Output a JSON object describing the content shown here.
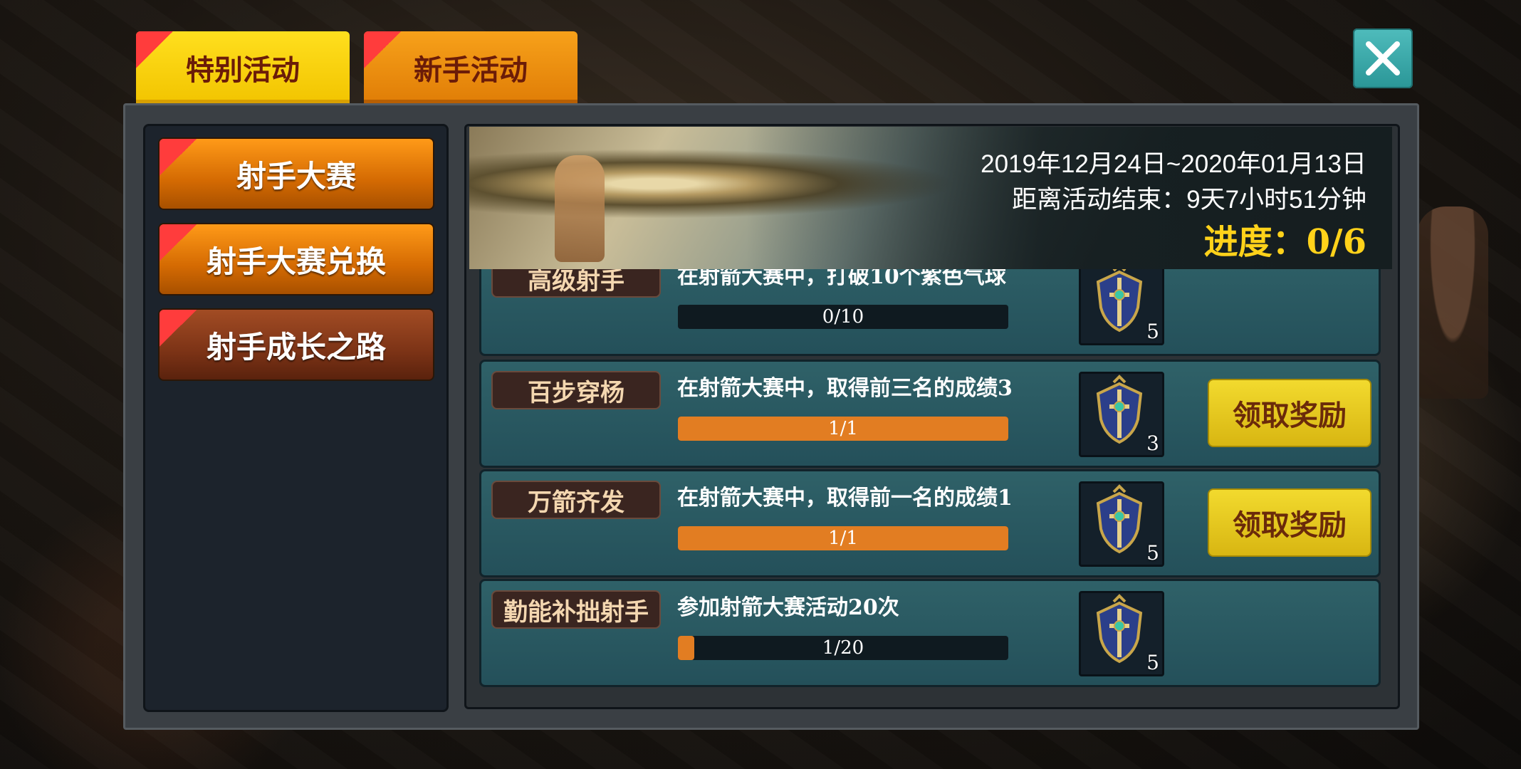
{
  "top_tabs": [
    {
      "label": "特别活动",
      "active": true
    },
    {
      "label": "新手活动",
      "active": false
    }
  ],
  "sidebar": {
    "items": [
      {
        "label": "射手大赛"
      },
      {
        "label": "射手大赛兑换"
      },
      {
        "label": "射手成长之路",
        "selected": true
      }
    ]
  },
  "banner": {
    "date_range": "2019年12月24日~2020年01月13日",
    "time_remaining": "距离活动结束：9天7小时51分钟",
    "progress": "进度：0/6"
  },
  "tasks": [
    {
      "name": "高级射手",
      "desc": "在射箭大赛中，打破10个紫色气球",
      "progress_text": "0/10",
      "progress_fraction": 0.0,
      "reward_count": "5",
      "reward_icon": "shield-sword-icon"
    },
    {
      "name": "百步穿杨",
      "desc": "在射箭大赛中，取得前三名的成绩3",
      "progress_text": "1/1",
      "progress_fraction": 1.0,
      "reward_count": "3",
      "reward_icon": "shield-sword-icon",
      "claim_label": "领取奖励"
    },
    {
      "name": "万箭齐发",
      "desc": "在射箭大赛中，取得前一名的成绩1",
      "progress_text": "1/1",
      "progress_fraction": 1.0,
      "reward_count": "5",
      "reward_icon": "shield-sword-icon",
      "claim_label": "领取奖励"
    },
    {
      "name": "勤能补拙射手",
      "desc": "参加射箭大赛活动20次",
      "progress_text": "1/20",
      "progress_fraction": 0.05,
      "reward_count": "5",
      "reward_icon": "shield-sword-icon"
    }
  ],
  "close_icon": "close-icon"
}
